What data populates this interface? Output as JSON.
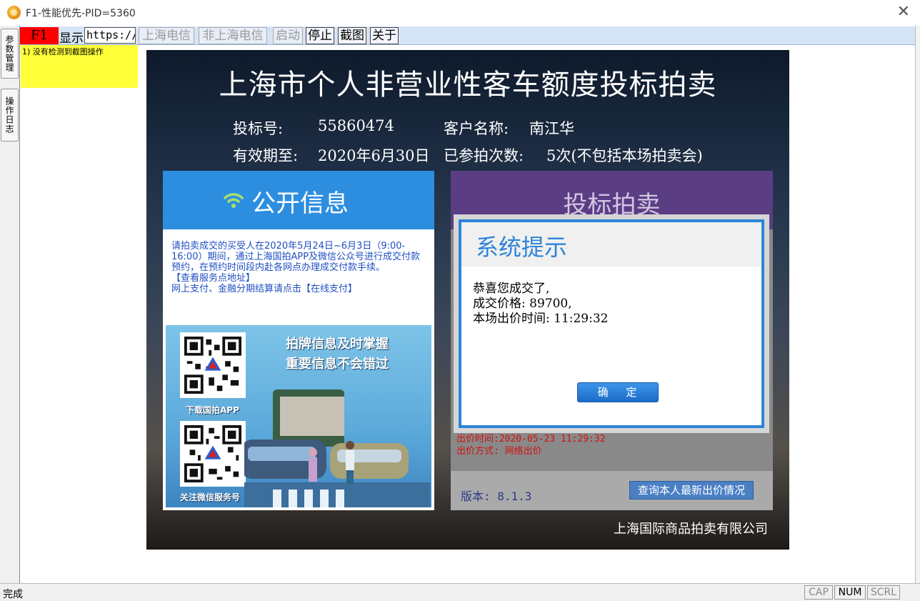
{
  "window": {
    "title": "F1-性能优先-PID=5360",
    "close_glyph": "✕"
  },
  "side_tabs": [
    "参数管理",
    "操作日志"
  ],
  "toolbar": {
    "f1": "F1",
    "show": "显示",
    "url_value": "https://",
    "buttons": {
      "shanghai_telecom": "上海电信",
      "non_shanghai_telecom": "非上海电信",
      "start": "启动",
      "stop": "停止",
      "screenshot": "截图",
      "about": "关于"
    }
  },
  "log": {
    "line1": "1) 没有检测到截图操作"
  },
  "auction": {
    "title": "上海市个人非营业性客车额度投标拍卖",
    "bid_no_label": "投标号:",
    "bid_no": "55860474",
    "customer_label": "客户名称:",
    "customer": "南江华",
    "valid_label": "有效期至:",
    "valid_date": "2020年6月30日",
    "attempts_label": "已参拍次数:",
    "attempts": "5次(不包括本场拍卖会)",
    "public_info": {
      "title": "公开信息",
      "text1": "请拍卖成交的买受人在2020年5月24日~6月3日（9:00-16:00）期间，通过上海国拍APP及微信公众号进行成交付款预约，在预约时间段内赴各网点办理成交付款手续。",
      "link1": "【查看服务点地址】",
      "text2": "网上支付、金融分期结算请点击",
      "link2": "【在线支付】",
      "slogan1": "拍牌信息及时掌握",
      "slogan2": "重要信息不会错过",
      "qr1_caption": "下载国拍APP",
      "qr2_caption": "关注微信服务号"
    },
    "bid": {
      "title": "投标拍卖",
      "bid_time": "出价时间:2020-05-23 11:29:32",
      "bid_method": "出价方式: 网络出价",
      "version": "版本: 8.1.3",
      "query_button": "查询本人最新出价情况"
    },
    "company": "上海国际商品拍卖有限公司"
  },
  "dialog": {
    "title": "系统提示",
    "line1": "恭喜您成交了,",
    "line2": "成交价格: 89700,",
    "line3": "本场出价时间: 11:29:32",
    "ok": "确 定"
  },
  "statusbar": {
    "text": "完成",
    "cap": "CAP",
    "num": "NUM",
    "scrl": "SCRL"
  },
  "colors": {
    "toolbar_bg": "#d6e4f7",
    "f1_red": "#ff0000",
    "log_yellow": "#ffff3a",
    "public_blue": "#2d8ee0",
    "bid_purple": "#5b3d84",
    "dialog_blue": "#2d84d8"
  }
}
